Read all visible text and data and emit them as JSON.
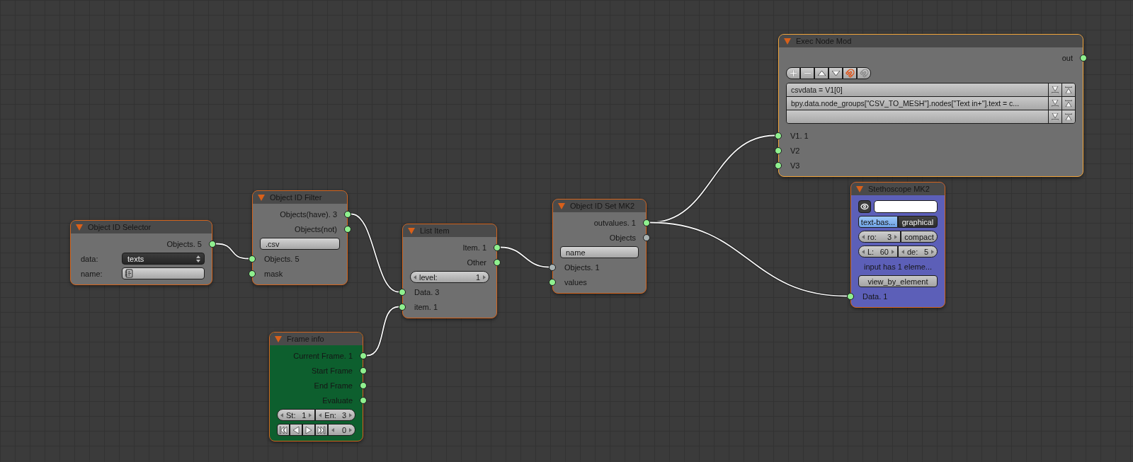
{
  "nodes": [
    {
      "title": "Object ID Selector",
      "color": "#6f6f6f",
      "active": false,
      "rows": [
        {
          "kind": "output",
          "label": "Objects. 5",
          "color": "#8ff08f"
        },
        {
          "kind": "dropdown",
          "label": "data:",
          "value": "texts"
        },
        {
          "kind": "id-field",
          "label": "name:"
        }
      ]
    },
    {
      "title": "Object ID Filter",
      "color": "#6f6f6f",
      "active": false,
      "rows": [
        {
          "kind": "output",
          "label": "Objects(have). 3",
          "color": "#8ff08f"
        },
        {
          "kind": "output",
          "label": "Objects(not)",
          "color": "#8ff08f"
        },
        {
          "kind": "text-field",
          "value": ".csv"
        },
        {
          "kind": "input",
          "label": "Objects. 5",
          "color": "#8ff08f"
        },
        {
          "kind": "input",
          "label": "mask",
          "color": "#8ff08f"
        }
      ]
    },
    {
      "title": "List Item",
      "color": "#6f6f6f",
      "active": false,
      "rows": [
        {
          "kind": "output",
          "label": "Item. 1",
          "color": "#8ff08f"
        },
        {
          "kind": "output",
          "label": "Other",
          "color": "#8ff08f"
        },
        {
          "kind": "number",
          "label": "level:",
          "value": "1"
        },
        {
          "kind": "input",
          "label": "Data. 3",
          "color": "#8ff08f"
        },
        {
          "kind": "input",
          "label": "item. 1",
          "color": "#8ff08f"
        }
      ]
    },
    {
      "title": "Frame info",
      "color": "#0d5f2e",
      "active": false,
      "rows": [
        {
          "kind": "output",
          "label": "Current Frame. 1",
          "color": "#8ff08f"
        },
        {
          "kind": "output",
          "label": "Start Frame",
          "color": "#8ff08f"
        },
        {
          "kind": "output",
          "label": "End Frame",
          "color": "#8ff08f"
        },
        {
          "kind": "output",
          "label": "Evaluate",
          "color": "#8ff08f"
        },
        {
          "kind": "number-pair",
          "items": [
            {
              "label": "St:",
              "value": "1"
            },
            {
              "label": "En:",
              "value": "3"
            }
          ]
        },
        {
          "kind": "transport",
          "value": "0"
        }
      ]
    },
    {
      "title": "Object ID Set MK2",
      "color": "#6f6f6f",
      "active": false,
      "rows": [
        {
          "kind": "output",
          "label": "outvalues. 1",
          "color": "#8ff08f"
        },
        {
          "kind": "output",
          "label": "Objects",
          "color": "#a9b3b3"
        },
        {
          "kind": "text-field",
          "value": "name"
        },
        {
          "kind": "input",
          "label": "Objects. 1",
          "color": "#a9b3b3"
        },
        {
          "kind": "input",
          "label": "values",
          "color": "#8ff08f"
        }
      ]
    },
    {
      "title": "Exec Node Mod",
      "color": "#6f6f6f",
      "active": true,
      "rows": [
        {
          "kind": "output",
          "label": "out",
          "color": "#8ff08f"
        },
        {
          "kind": "toolbar"
        },
        {
          "kind": "script-list",
          "lines": [
            {
              "text": "csvdata = V1[0]"
            },
            {
              "text": "bpy.data.node_groups[\"CSV_TO_MESH\"].nodes[\"Text in+\"].text = c..."
            }
          ]
        },
        {
          "kind": "input",
          "label": "V1. 1",
          "color": "#8ff08f"
        },
        {
          "kind": "input",
          "label": "V2",
          "color": "#8ff08f"
        },
        {
          "kind": "input",
          "label": "V3",
          "color": "#8ff08f"
        }
      ]
    },
    {
      "title": "Stethoscope MK2",
      "color": "#5c5fb8",
      "active": false,
      "rows": [
        {
          "kind": "eye-field"
        },
        {
          "kind": "toggle",
          "options": [
            {
              "label": "text-bas...",
              "selected": true
            },
            {
              "label": "graphical",
              "selected": false
            }
          ]
        },
        {
          "kind": "number-button",
          "number": {
            "label": "ro:",
            "value": "3"
          },
          "button": "compact"
        },
        {
          "kind": "number-pair",
          "items": [
            {
              "label": "L:",
              "value": "60"
            },
            {
              "label": "de:",
              "value": "5"
            }
          ]
        },
        {
          "kind": "label",
          "text": "input has 1 eleme..."
        },
        {
          "kind": "button",
          "label": "view_by_element"
        },
        {
          "kind": "input",
          "label": "Data. 1",
          "color": "#8ff08f"
        }
      ]
    }
  ]
}
